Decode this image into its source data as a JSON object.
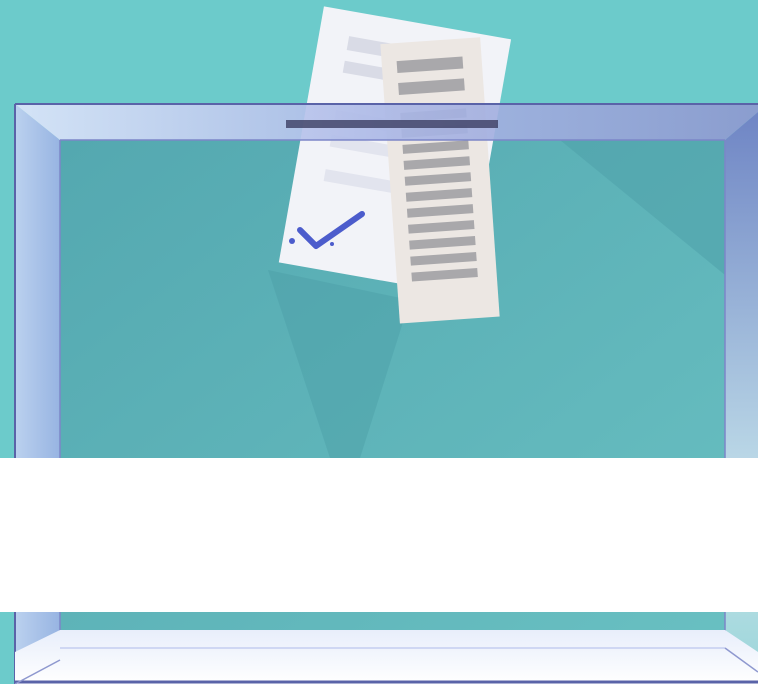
{
  "scene": {
    "subject": "ballot-box-illustration",
    "colors": {
      "background": "#6ccbcb",
      "box_inner": "#5fb4b8",
      "box_rim": "#b9c4ee",
      "box_frame": "#5a63a8",
      "ballot_paper": "#f2f3f8",
      "receipt_paper": "#ece7e3",
      "check_mark": "#4c5ccc",
      "band": "#ffffff"
    },
    "icons": [
      "ballot-box",
      "ballot-paper",
      "receipt",
      "check-mark-icon"
    ]
  }
}
